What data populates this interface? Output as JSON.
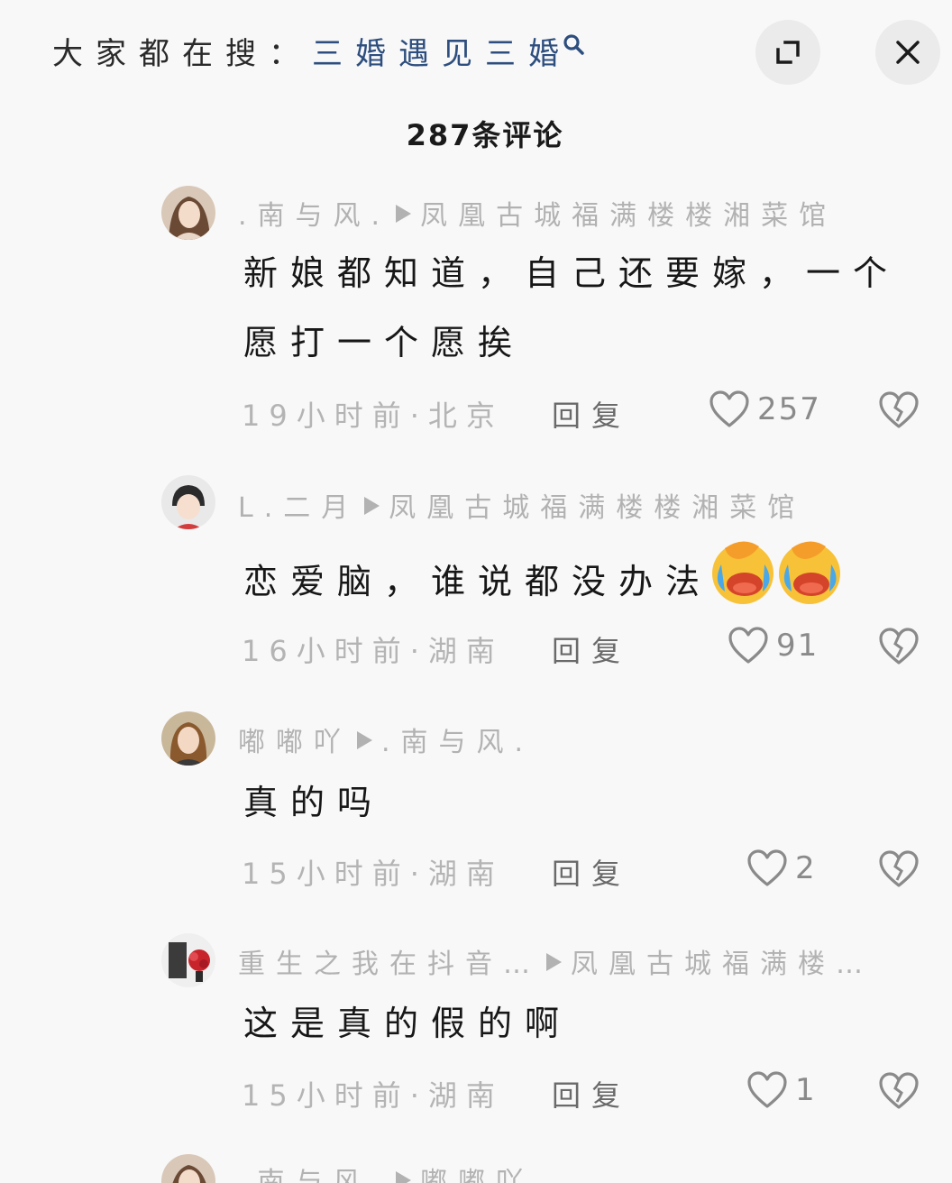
{
  "header": {
    "search_prefix": "大家都在搜：",
    "search_term": "三婚遇见三婚",
    "comment_count": "287条评论"
  },
  "comments": [
    {
      "user": ".南与风.",
      "reply_to": "凤凰古城福满楼楼湘菜馆",
      "text": "新娘都知道，自己还要嫁，一个愿打一个愿挨",
      "meta": "19小时前·北京",
      "reply_label": "回复",
      "likes": "257"
    },
    {
      "user": "L.二月",
      "reply_to": "凤凰古城福满楼楼湘菜馆",
      "text": "恋爱脑，谁说都没办法",
      "meta": "16小时前·湖南",
      "reply_label": "回复",
      "likes": "91"
    },
    {
      "user": "嘟嘟吖",
      "reply_to": ".南与风.",
      "text": "真的吗",
      "meta": "15小时前·湖南",
      "reply_label": "回复",
      "likes": "2"
    },
    {
      "user": "重生之我在抖音…",
      "reply_to": "凤凰古城福满楼…",
      "text": "这是真的假的啊",
      "meta": "15小时前·湖南",
      "reply_label": "回复",
      "likes": "1"
    },
    {
      "user": ".南与风.",
      "reply_to": "嘟嘟吖"
    }
  ],
  "colors": {
    "background": "#f8f8f8",
    "search_term": "#2d4e7e",
    "text": "#171717",
    "muted": "#b2b2b2"
  },
  "icons": [
    "search-icon",
    "expand-icon",
    "close-icon",
    "heart-icon",
    "broken-heart-icon",
    "laughing-crying-emoji"
  ]
}
